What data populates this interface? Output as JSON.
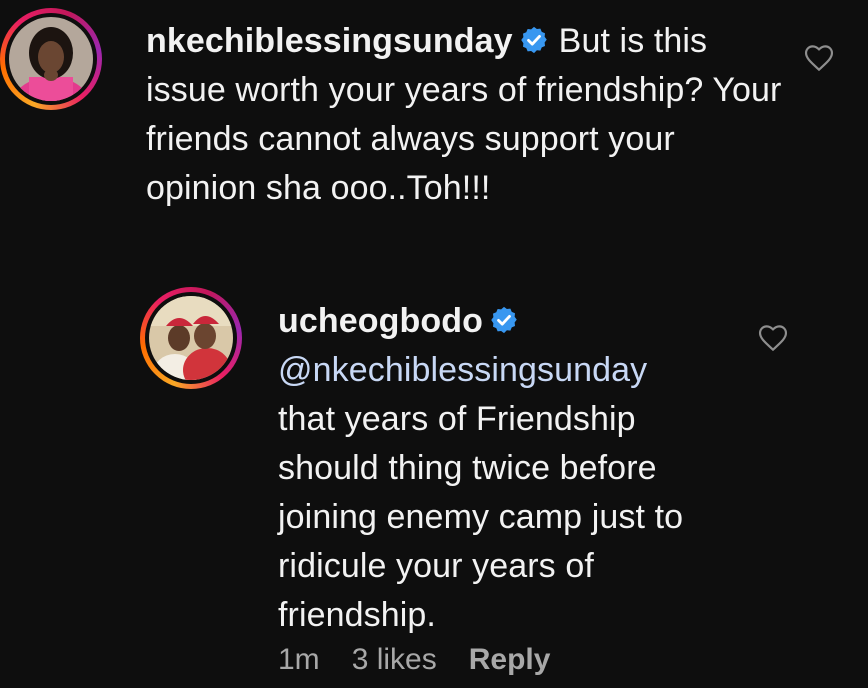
{
  "comment": {
    "username": "nkechiblessingsunday",
    "verified_icon": "verified-badge-icon",
    "text": "But is this issue worth your years of friendship? Your friends cannot always support your opinion sha ooo..Toh!!!",
    "like_icon": "heart-outline-icon"
  },
  "reply": {
    "username": "ucheogbodo",
    "verified_icon": "verified-badge-icon",
    "mention": "@nkechiblessingsunday",
    "text": "that years of Friendship should thing twice before joining enemy camp just to ridicule your years of friendship.",
    "like_icon": "heart-outline-icon",
    "time": "1m",
    "likes": "3 likes",
    "reply_label": "Reply"
  },
  "colors": {
    "background": "#0e0e0e",
    "text": "#f2f2f2",
    "meta": "#a8a8a8",
    "verified_blue": "#3897f0",
    "mention": "#c8d8f5"
  }
}
